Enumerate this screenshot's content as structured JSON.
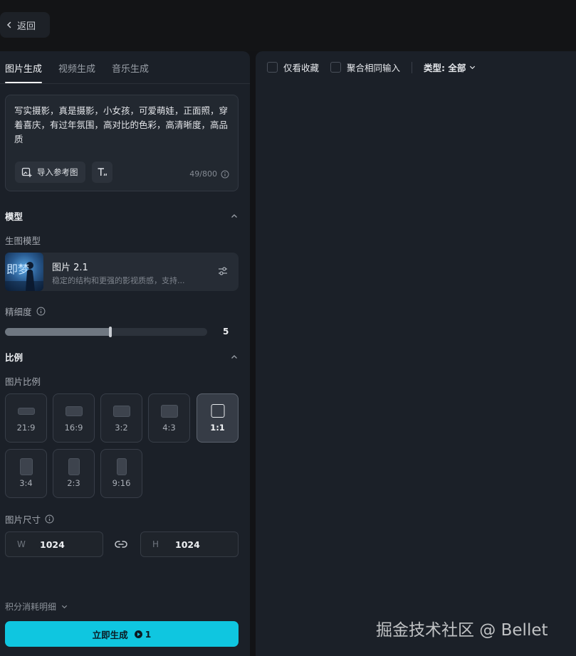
{
  "header": {
    "back_label": "返回"
  },
  "tabs": [
    {
      "label": "图片生成",
      "active": true
    },
    {
      "label": "视频生成",
      "active": false
    },
    {
      "label": "音乐生成",
      "active": false
    }
  ],
  "prompt": {
    "text": "写实摄影，真是摄影，小女孩，可爱萌娃，正面照，穿着喜庆，有过年氛围，高对比的色彩，高清晰度，高品质",
    "import_label": "导入参考图",
    "char_count": "49/800"
  },
  "model_section": {
    "title": "模型",
    "sub_label": "生图模型",
    "model_name": "图片 2.1",
    "model_desc": "稳定的结构和更强的影视质感，支持...",
    "thumb_text": "即梦"
  },
  "precision": {
    "label": "精细度",
    "value": "5",
    "fraction": 0.5
  },
  "ratio_section": {
    "title": "比例",
    "sub_label": "图片比例",
    "options": [
      "21:9",
      "16:9",
      "3:2",
      "4:3",
      "1:1",
      "3:4",
      "2:3",
      "9:16"
    ],
    "selected": "1:1"
  },
  "size": {
    "label": "图片尺寸",
    "w_prefix": "W",
    "w_value": "1024",
    "h_prefix": "H",
    "h_value": "1024"
  },
  "footer": {
    "cost_detail_label": "积分消耗明细",
    "generate_label": "立即生成",
    "generate_cost": "1"
  },
  "filters": {
    "favorites_label": "仅看收藏",
    "aggregate_label": "聚合相同输入",
    "type_label": "类型: 全部"
  },
  "watermark": "掘金技术社区 @ Bellet",
  "colors": {
    "accent": "#0fc6e0",
    "panel": "#1b2028",
    "background": "#121316"
  }
}
